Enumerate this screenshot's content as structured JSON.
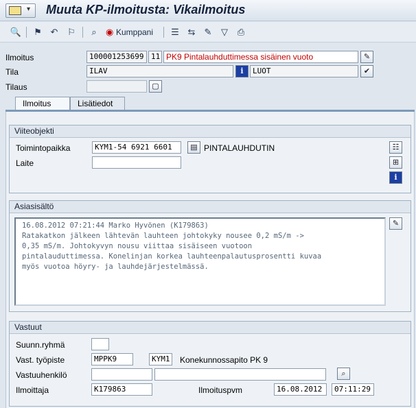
{
  "window": {
    "title": "Muuta KP-ilmoitusta: Vikailmoitus"
  },
  "toolbar": {
    "buttons": [
      {
        "name": "display-icon"
      },
      {
        "name": "flag-activate-icon"
      },
      {
        "name": "flag-undo-icon"
      },
      {
        "name": "flag-complete-icon"
      },
      {
        "name": "binoculars-icon"
      },
      {
        "name": "partner-icon"
      },
      {
        "name": "document-list-icon"
      },
      {
        "name": "transfer-icon"
      },
      {
        "name": "settlement-icon"
      },
      {
        "name": "filter-icon"
      },
      {
        "name": "print-icon"
      }
    ],
    "partner_label": "Kumppani"
  },
  "header": {
    "ilmoitus_label": "Ilmoitus",
    "ilmoitus_number": "100001253699",
    "ilmoitus_type": "11",
    "ilmoitus_description": "PK9 Pintalauhduttimessa sisäinen vuoto",
    "tila_label": "Tila",
    "tila_status": "ILAV",
    "tila_user_status": "LUOT",
    "tilaus_label": "Tilaus",
    "tilaus_value": ""
  },
  "tabs": [
    {
      "label": "Ilmoitus",
      "active": true
    },
    {
      "label": "Lisätiedot",
      "active": false
    }
  ],
  "viiteobjekti": {
    "title": "Viiteobjekti",
    "toimintopaikka_label": "Toimintopaikka",
    "toimintopaikka_value": "KYM1-54 6921 6601",
    "toimintopaikka_text": "PINTALAUHDUTIN",
    "laite_label": "Laite",
    "laite_value": ""
  },
  "asiasisalto": {
    "title": "Asiasisältö",
    "lines": [
      "16.08.2012 07:21:44 Marko Hyvönen (K179863)",
      "Ratakatkon jälkeen lähtevän lauhteen johtokyky nousee 0,2 mS/m ->",
      "0,35 mS/m. Johtokyvyn nousu viittaa sisäiseen vuotoon",
      "pintalauduttimessa. Konelinjan korkea lauhteenpalautusprosentti kuvaa",
      "myös vuotoa höyry- ja lauhdejärjestelmässä."
    ]
  },
  "vastuut": {
    "title": "Vastuut",
    "suunn_ryhma_label": "Suunn.ryhmä",
    "suunn_ryhma_value": "",
    "vast_tyopiste_label": "Vast. työpiste",
    "vast_tyopiste_value": "MPPK9",
    "vast_tyopiste_plant": "KYM1",
    "vast_tyopiste_text": "Konekunnossapito PK 9",
    "vastuuhenkilo_label": "Vastuuhenkilö",
    "vastuuhenkilo_value": "",
    "vastuuhenkilo_name": "",
    "ilmoittaja_label": "Ilmoittaja",
    "ilmoittaja_value": "K179863",
    "ilmoituspvm_label": "Ilmoituspvm",
    "ilmoituspvm_date": "16.08.2012",
    "ilmoituspvm_time": "07:11:29"
  }
}
